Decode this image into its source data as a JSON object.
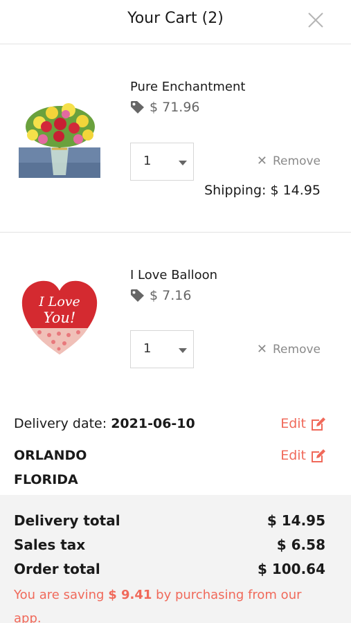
{
  "header": {
    "title": "Your Cart (2)"
  },
  "icons": {
    "close": "close-icon",
    "tag": "price-tag-icon",
    "edit": "edit-icon"
  },
  "colors": {
    "accent": "#f0695a",
    "muted": "#8a8a8a",
    "summary_bg": "#f3f3f3"
  },
  "items": [
    {
      "name": "Pure Enchantment",
      "price": "$ 71.96",
      "quantity": "1",
      "remove_label": "Remove",
      "shipping_label": "Shipping:",
      "shipping_value": "$ 14.95"
    },
    {
      "name": "I Love Balloon",
      "price": "$ 7.16",
      "quantity": "1",
      "remove_label": "Remove",
      "balloon_text": [
        "I Love",
        "You!"
      ]
    }
  ],
  "delivery": {
    "date_label": "Delivery date:",
    "date_value": "2021-06-10",
    "city": "ORLANDO",
    "state": "FLORIDA",
    "edit_label": "Edit"
  },
  "summary": {
    "delivery_total_label": "Delivery total",
    "delivery_total_value": "$ 14.95",
    "sales_tax_label": "Sales tax",
    "sales_tax_value": "$ 6.58",
    "order_total_label": "Order total",
    "order_total_value": "$ 100.64",
    "saving_prefix": "You are saving",
    "saving_amount": "$ 9.41",
    "saving_suffix": "by purchasing from our app."
  }
}
